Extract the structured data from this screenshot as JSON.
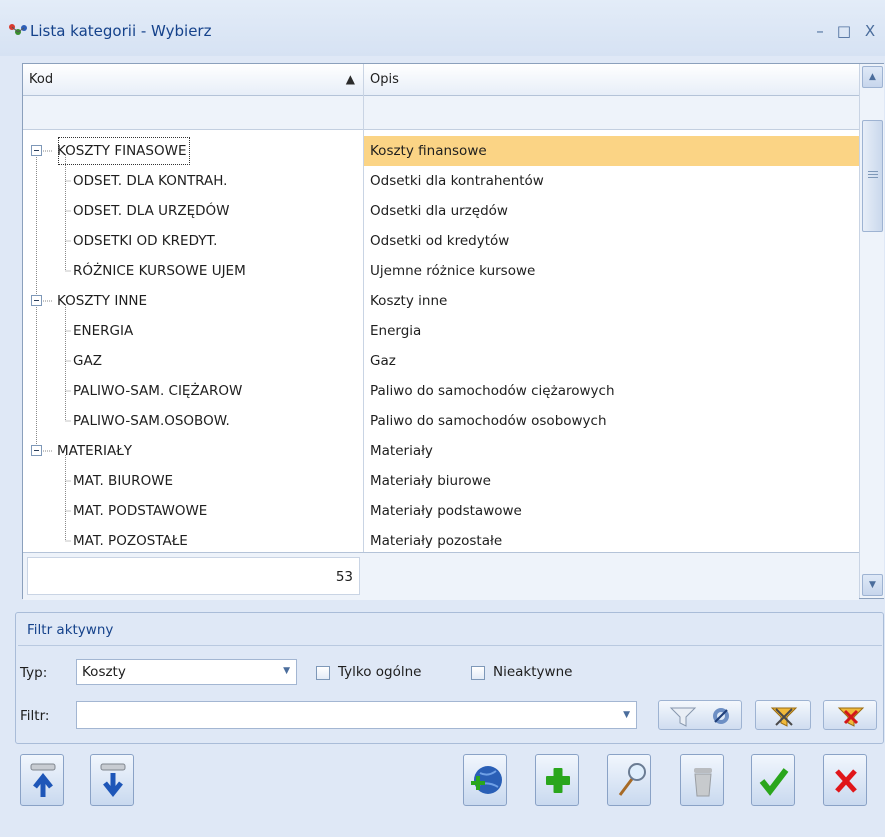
{
  "window": {
    "title": "Lista kategorii - Wybierz",
    "minimize": "–",
    "maximize": "□",
    "close": "X"
  },
  "grid": {
    "columns": [
      {
        "label": "Kod",
        "sort": "ascending"
      },
      {
        "label": "Opis"
      }
    ],
    "rows": [
      {
        "code": "KOSZTY FINASOWE",
        "description": "Koszty finansowe",
        "level": 0,
        "expanded": true,
        "selected": true
      },
      {
        "code": "ODSET. DLA KONTRAH.",
        "description": "Odsetki dla kontrahentów",
        "level": 1
      },
      {
        "code": "ODSET. DLA URZĘDÓW",
        "description": "Odsetki dla urzędów",
        "level": 1
      },
      {
        "code": "ODSETKI OD KREDYT.",
        "description": "Odsetki od kredytów",
        "level": 1
      },
      {
        "code": "RÓŻNICE KURSOWE UJEM",
        "description": "Ujemne różnice kursowe",
        "level": 1
      },
      {
        "code": "KOSZTY INNE",
        "description": "Koszty inne",
        "level": 0,
        "expanded": true
      },
      {
        "code": "ENERGIA",
        "description": "Energia",
        "level": 1
      },
      {
        "code": "GAZ",
        "description": "Gaz",
        "level": 1
      },
      {
        "code": "PALIWO-SAM. CIĘŻAROW",
        "description": "Paliwo do samochodów ciężarowych",
        "level": 1
      },
      {
        "code": "PALIWO-SAM.OSOBOW.",
        "description": "Paliwo do samochodów osobowych",
        "level": 1
      },
      {
        "code": "MATERIAŁY",
        "description": "Materiały",
        "level": 0,
        "expanded": true
      },
      {
        "code": "MAT. BIUROWE",
        "description": "Materiały biurowe",
        "level": 1
      },
      {
        "code": "MAT. PODSTAWOWE",
        "description": "Materiały podstawowe",
        "level": 1
      },
      {
        "code": "MAT. POZOSTAŁE",
        "description": "Materiały pozostałe",
        "level": 1
      }
    ],
    "count": "53"
  },
  "filter": {
    "title": "Filtr aktywny",
    "type_label": "Typ:",
    "type_value": "Koszty",
    "only_general_label": "Tylko ogólne",
    "only_general_checked": false,
    "inactive_label": "Nieaktywne",
    "inactive_checked": false,
    "filter_label": "Filtr:",
    "filter_value": ""
  },
  "icons": {
    "app": "category-icon",
    "filter_tools": [
      "funnel-icon",
      "build-filter-icon",
      "filter-wizard-icon",
      "clear-filter-icon"
    ],
    "buttons": [
      "import-icon",
      "export-icon",
      "add-global-icon",
      "add-icon",
      "preview-icon",
      "delete-icon",
      "confirm-icon",
      "cancel-icon"
    ]
  },
  "colors": {
    "window_bg": "#dfe8f6",
    "title_text": "#15428b",
    "selection": "#fbd485",
    "confirm": "#2aa61c",
    "cancel": "#e0161a"
  }
}
